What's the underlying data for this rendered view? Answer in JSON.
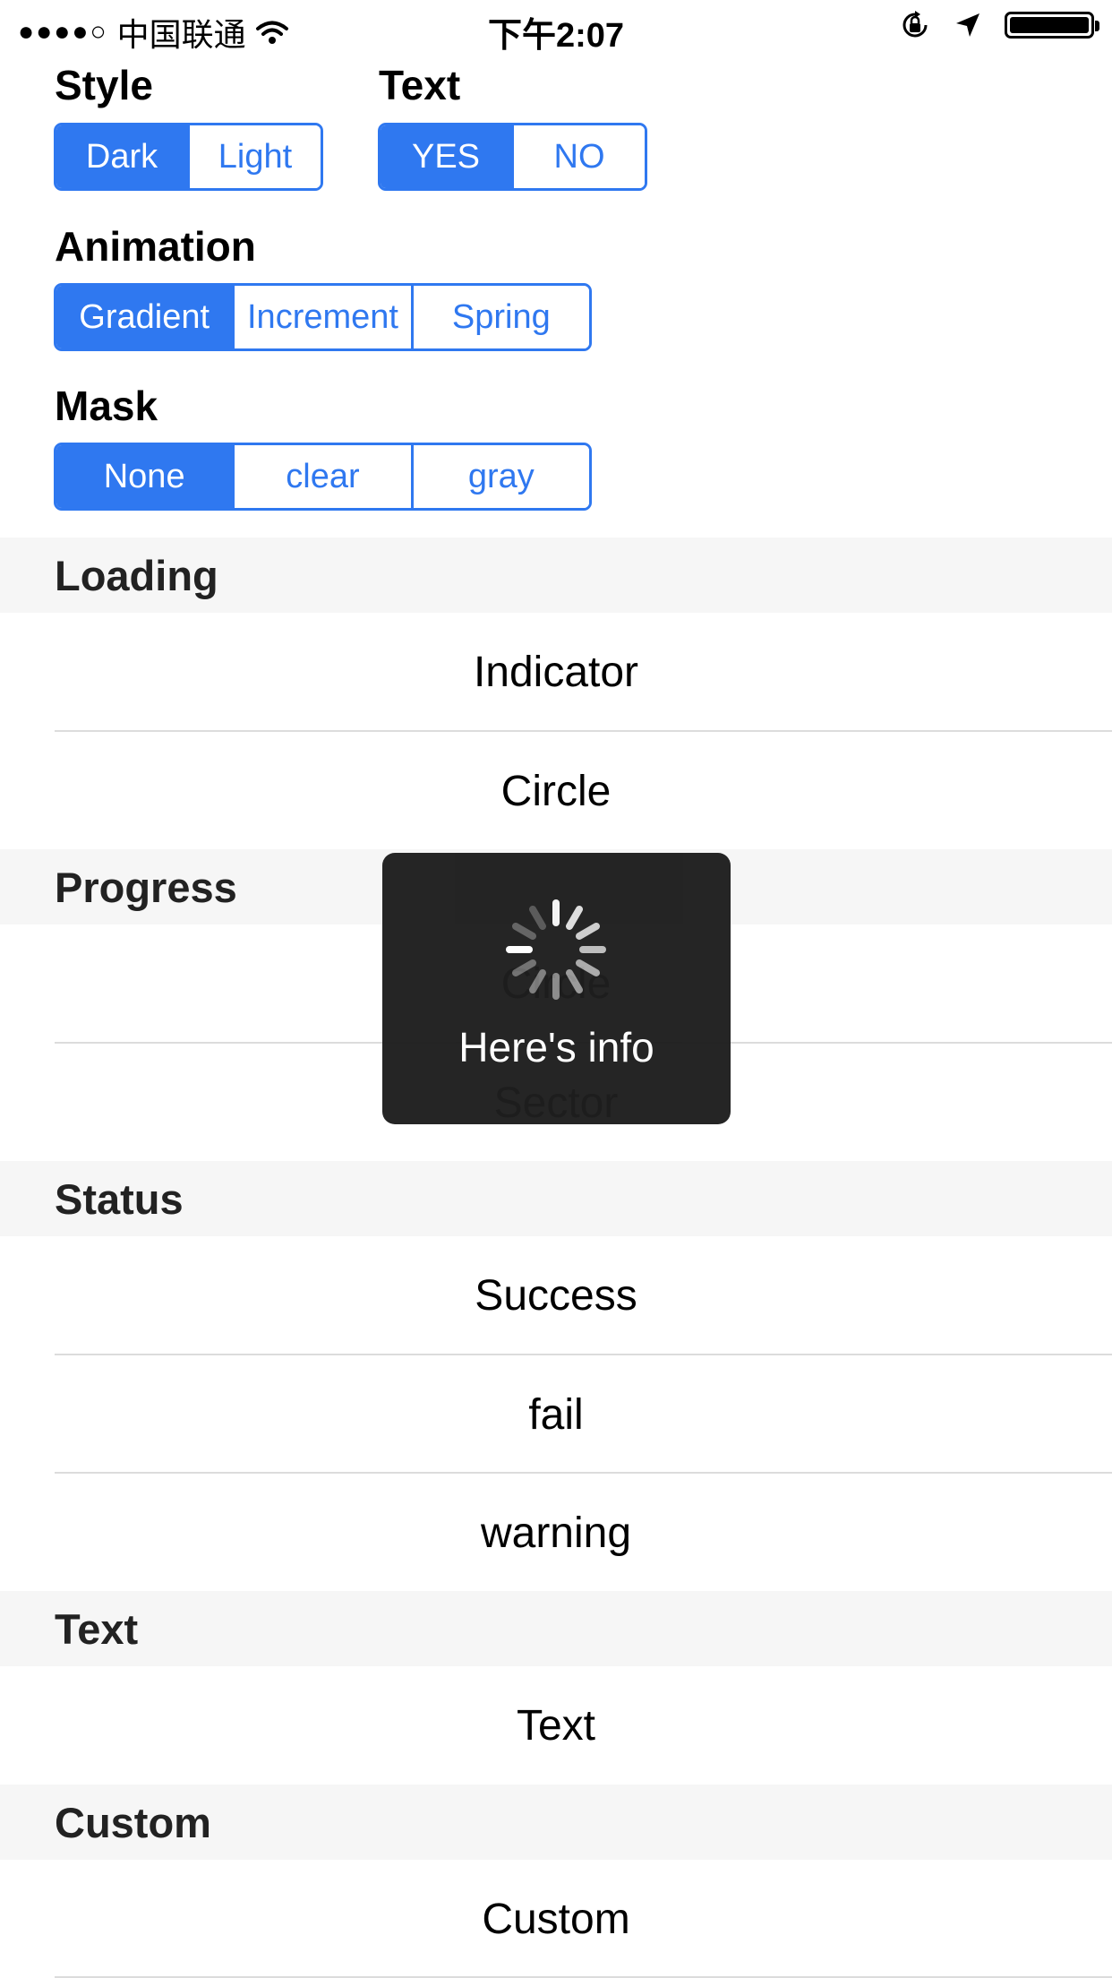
{
  "status_bar": {
    "signal": "●●●●○",
    "carrier": "中国联通",
    "time": "下午2:07"
  },
  "controls": {
    "style": {
      "label": "Style",
      "options": [
        "Dark",
        "Light"
      ],
      "selected": "Dark"
    },
    "text": {
      "label": "Text",
      "options": [
        "YES",
        "NO"
      ],
      "selected": "YES"
    },
    "animation": {
      "label": "Animation",
      "options": [
        "Gradient",
        "Increment",
        "Spring"
      ],
      "selected": "Gradient"
    },
    "mask": {
      "label": "Mask",
      "options": [
        "None",
        "clear",
        "gray"
      ],
      "selected": "None"
    }
  },
  "sections": [
    {
      "header": "Loading",
      "rows": [
        "Indicator",
        "Circle"
      ]
    },
    {
      "header": "Progress",
      "rows": [
        "Circle",
        "Sector"
      ]
    },
    {
      "header": "Status",
      "rows": [
        "Success",
        "fail",
        "warning"
      ]
    },
    {
      "header": "Text",
      "rows": [
        "Text"
      ]
    },
    {
      "header": "Custom",
      "rows": [
        "Custom"
      ]
    }
  ],
  "hud": {
    "text": "Here's info"
  },
  "colors": {
    "accent": "#2f78f0",
    "hud_bg": "#1e1e1e",
    "section_bg": "#f6f6f6"
  }
}
